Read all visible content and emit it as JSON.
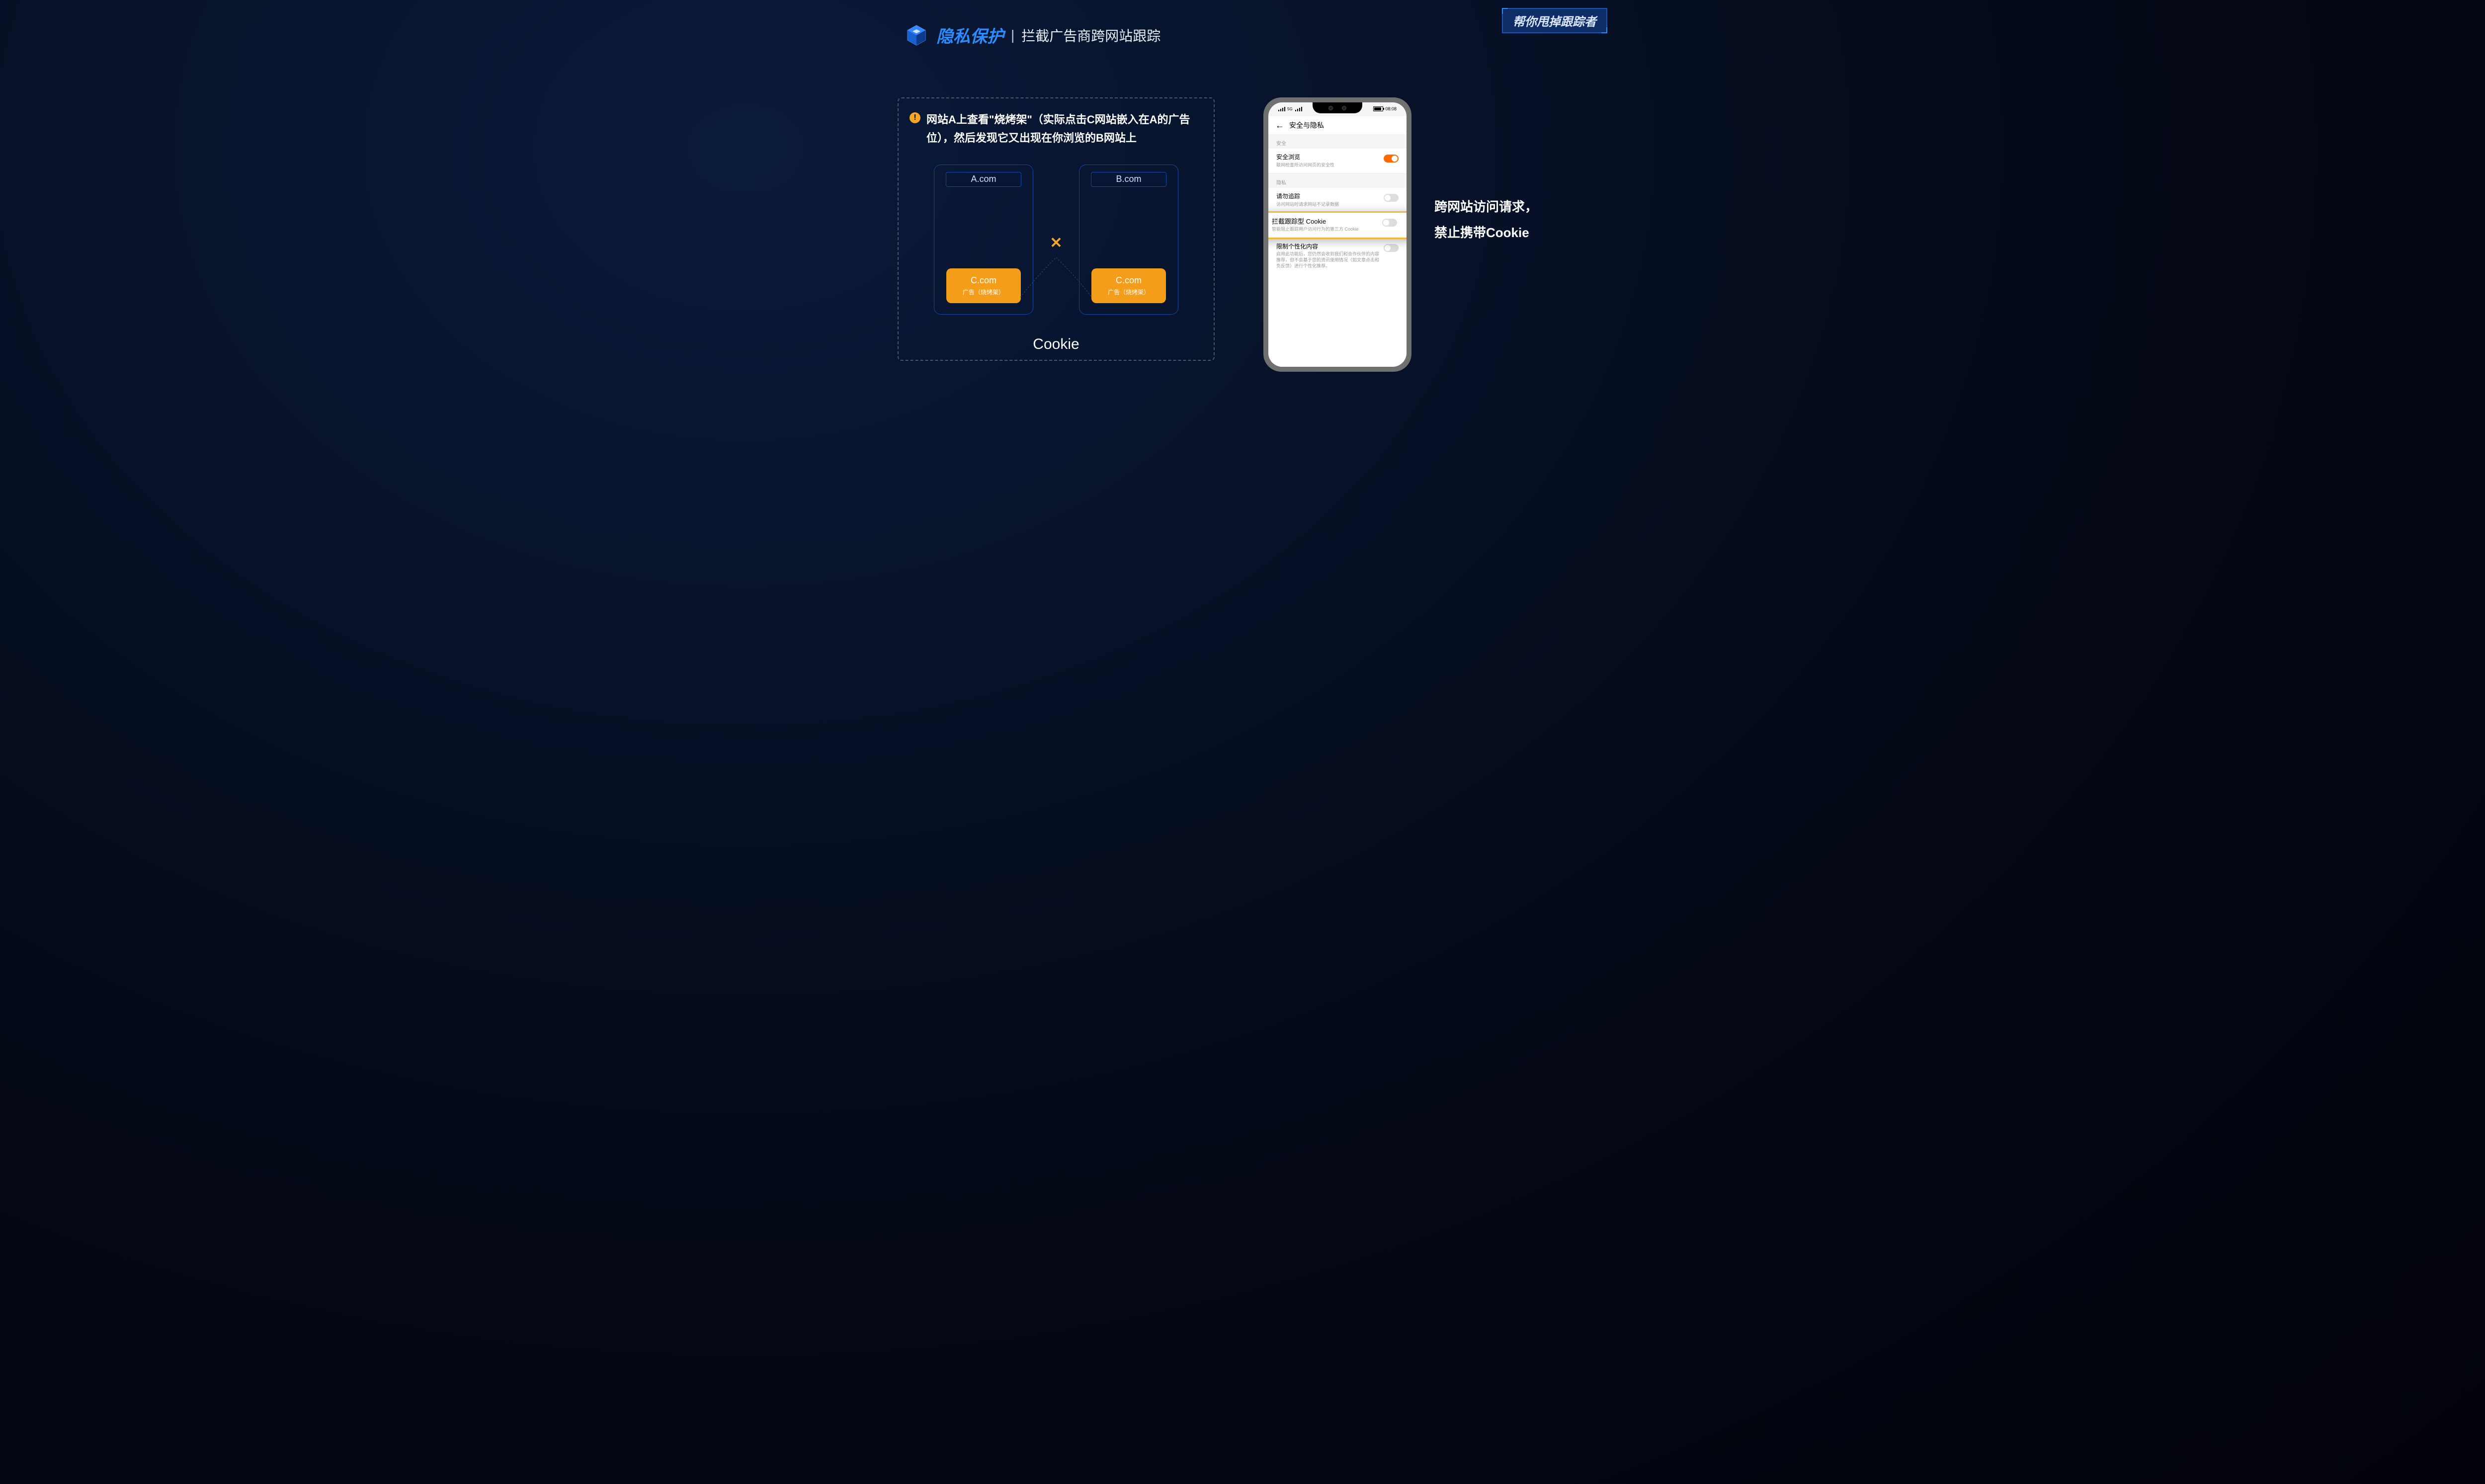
{
  "header": {
    "title_strong": "隐私保护",
    "separator": "|",
    "title_sub": "拦截广告商跨网站跟踪"
  },
  "badge_top_right": "帮你甩掉跟踪者",
  "left_panel": {
    "alert_icon": "!",
    "alert_text": "网站A上查看\"烧烤架\"（实际点击C网站嵌入在A的广告位），然后发现它又出现在你浏览的B网站上",
    "site_a": {
      "url": "A.com",
      "ad_domain": "C.com",
      "ad_desc": "广告（烧烤架）"
    },
    "site_b": {
      "url": "B.com",
      "ad_domain": "C.com",
      "ad_desc": "广告（烧烤架）"
    },
    "x_mark": "✕",
    "bottom_label": "Cookie"
  },
  "phone": {
    "status_time": "08:08",
    "signal_label": "5G",
    "screen_title": "安全与隐私",
    "section_security": "安全",
    "row_safe_browse": {
      "title": "安全浏览",
      "desc": "联网检查所访问网页的安全性"
    },
    "section_privacy": "隐私",
    "row_dnt": {
      "title": "请勿追踪",
      "desc": "访问网站时请求网站不记录数据"
    },
    "row_block_cookie": {
      "title": "拦截跟踪型 Cookie",
      "desc": "智能阻止跟踪用户访问行为的第三方 Cookie"
    },
    "row_personal": {
      "title": "限制个性化内容",
      "desc": "启用此功能后，您仍然会收到我们和合作伙伴的内容推荐，但不会基于您的资讯使用情况（如文章点击和负反馈）进行个性化推荐。"
    }
  },
  "callout": {
    "line1": "跨网站访问请求，",
    "line2": "禁止携带Cookie"
  }
}
